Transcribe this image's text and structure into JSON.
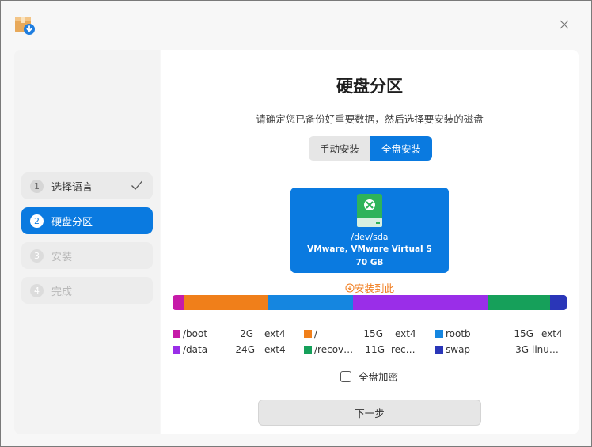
{
  "window": {
    "close_icon": "close-icon",
    "app_icon": "installer-package-icon"
  },
  "steps": [
    {
      "num": "1",
      "label": "选择语言",
      "state": "done"
    },
    {
      "num": "2",
      "label": "硬盘分区",
      "state": "active"
    },
    {
      "num": "3",
      "label": "安装",
      "state": "todo"
    },
    {
      "num": "4",
      "label": "完成",
      "state": "todo"
    }
  ],
  "main": {
    "title": "硬盘分区",
    "subtitle": "请确定您已备份好重要数据，然后选择要安装的磁盘",
    "modes": {
      "manual": "手动安装",
      "full": "全盘安装",
      "selected": "full"
    },
    "disk": {
      "path": "/dev/sda",
      "model": "VMware, VMware Virtual S",
      "size": "70 GB"
    },
    "install_here": "安装到此",
    "partitions": [
      {
        "name": "/boot",
        "size": "2G",
        "fs": "ext4",
        "color": "#c61aa8",
        "gb": 2
      },
      {
        "name": "/",
        "size": "15G",
        "fs": "ext4",
        "color": "#f07f1a",
        "gb": 15
      },
      {
        "name": "rootb",
        "size": "15G",
        "fs": "ext4",
        "color": "#1586e0",
        "gb": 15
      },
      {
        "name": "/data",
        "size": "24G",
        "fs": "ext4",
        "color": "#9a2ee8",
        "gb": 24
      },
      {
        "name": "/recov…",
        "size": "11G",
        "fs": "rec…",
        "color": "#16a05a",
        "gb": 11
      },
      {
        "name": "swap",
        "size": "3G",
        "fs": "linu…",
        "color": "#2a36b8",
        "gb": 3
      }
    ],
    "encrypt_label": "全盘加密",
    "next_label": "下一步"
  }
}
